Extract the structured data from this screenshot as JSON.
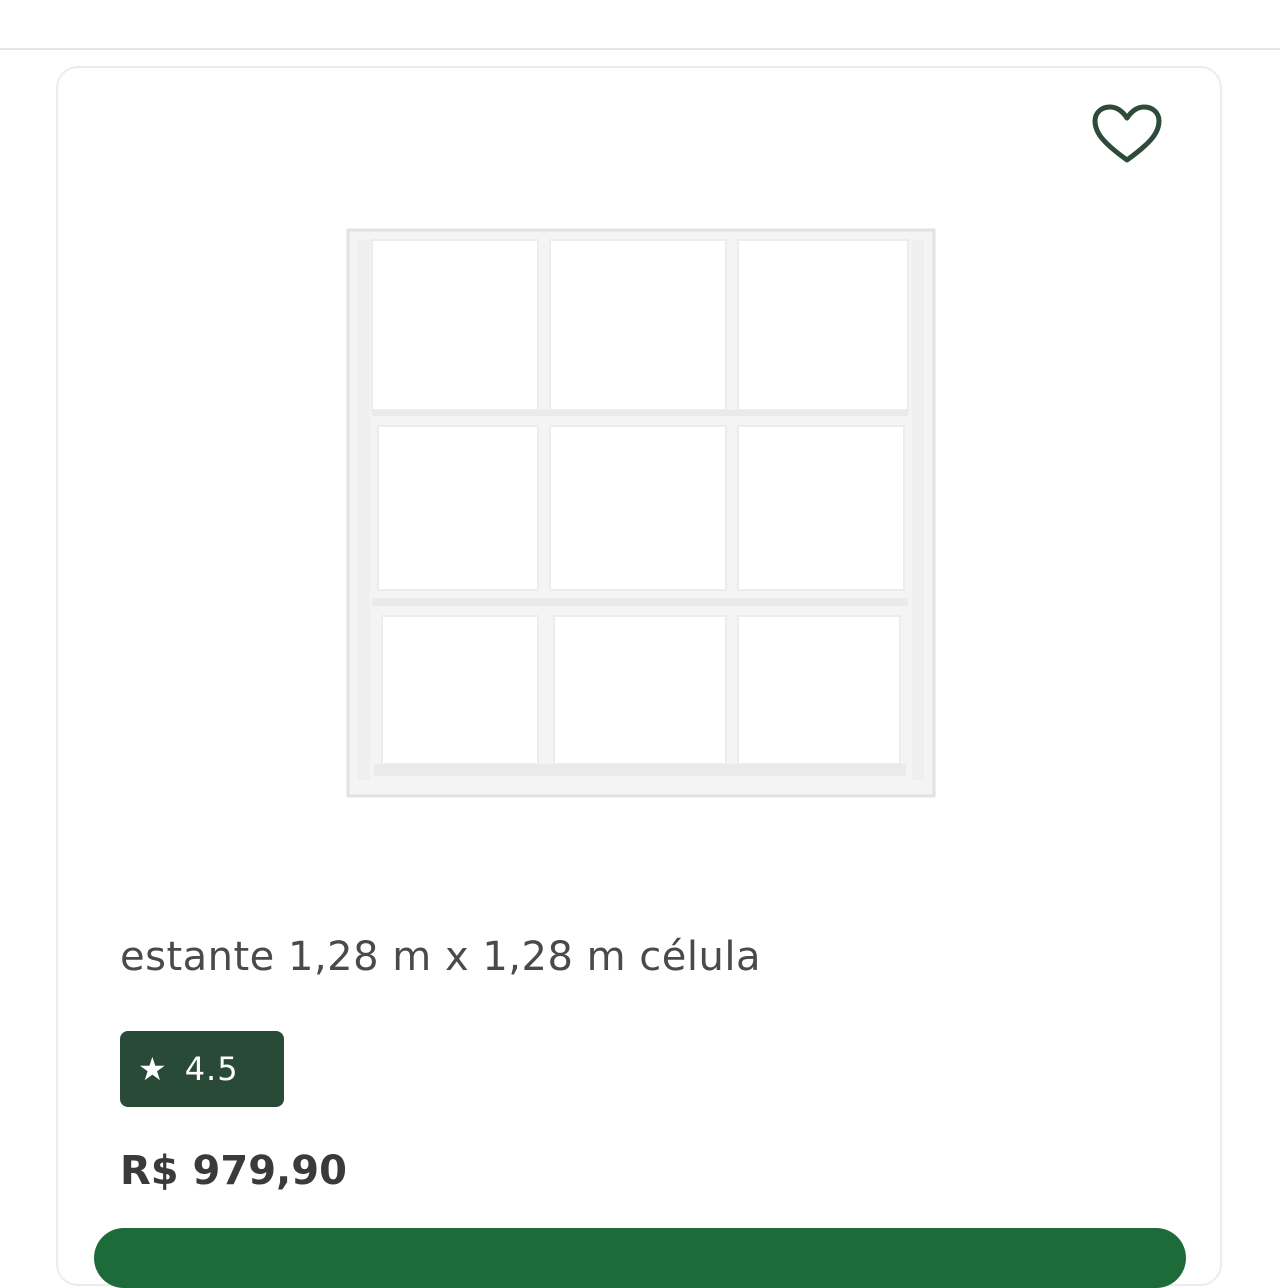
{
  "product": {
    "title": "estante 1,28 m x 1,28 m célula",
    "rating": "4.5",
    "rating_star": "★",
    "price": "R$ 979,90",
    "image_alt": "estante branca com 9 nichos"
  },
  "icons": {
    "favorite": "heart-outline-icon",
    "rating": "star-icon"
  },
  "colors": {
    "rating_badge_bg": "#2a4a38",
    "cta_green": "#1e6b3a",
    "heart_stroke": "#2d4a3a",
    "title_text": "#4a4a4a",
    "price_text": "#3a3a3a"
  }
}
